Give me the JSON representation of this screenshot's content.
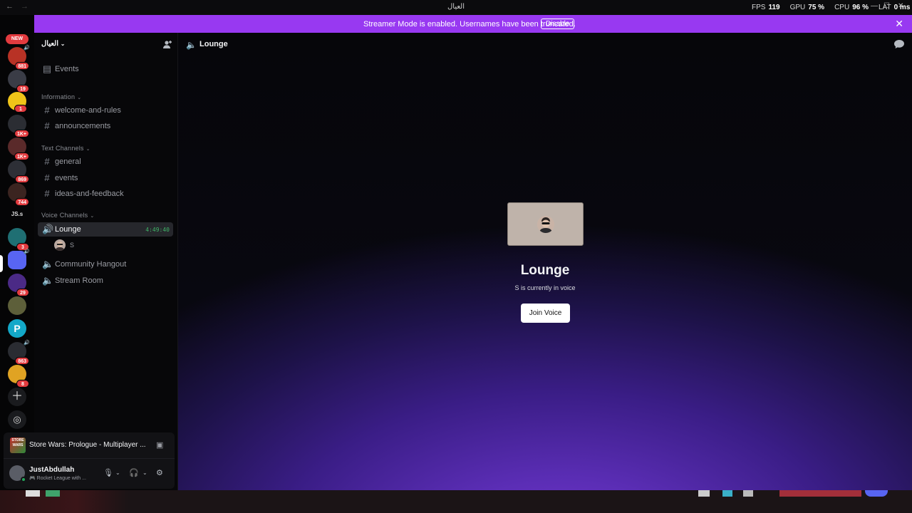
{
  "titlebar": {
    "title": "العيال",
    "stats": [
      {
        "label": "FPS",
        "value": "119"
      },
      {
        "label": "GPU",
        "value": "75 %"
      },
      {
        "label": "CPU",
        "value": "96 %"
      },
      {
        "label": "LAT",
        "value": "0 ms"
      }
    ]
  },
  "rail": {
    "new_label": "NEW",
    "badges": [
      "20",
      "881",
      "19",
      "1",
      "1K+",
      "1K+",
      "869",
      "744",
      "3",
      "29",
      "863",
      "8"
    ],
    "js_label": "JS.s"
  },
  "banner": {
    "message": "Streamer Mode is enabled. Usernames have been truncated.",
    "button": "Disable"
  },
  "server": {
    "name": "العيال"
  },
  "sidebar": {
    "events_label": "Events",
    "categories": [
      {
        "label": "Information",
        "channels": [
          "welcome-and-rules",
          "announcements"
        ]
      },
      {
        "label": "Text Channels",
        "channels": [
          "general",
          "events",
          "ideas-and-feedback"
        ]
      },
      {
        "label": "Voice Channels",
        "channels": [
          "Lounge",
          "Community Hangout",
          "Stream Room"
        ]
      }
    ],
    "lounge_timer": "4:49:40",
    "voice_user": "S"
  },
  "activity": {
    "game_icon_text": "STORE WARS",
    "title": "Store Wars: Prologue - Multiplayer ..."
  },
  "user": {
    "name": "JustAbdullah",
    "status": "🎮 Rocket League with ..."
  },
  "main": {
    "channel": "Lounge",
    "voice_title": "Lounge",
    "voice_subtitle": "S is currently in voice",
    "join_button": "Join Voice"
  },
  "colors": {
    "banner": "#9839f1",
    "accent_green": "#3fb467",
    "badge_red": "#e33b3f"
  }
}
